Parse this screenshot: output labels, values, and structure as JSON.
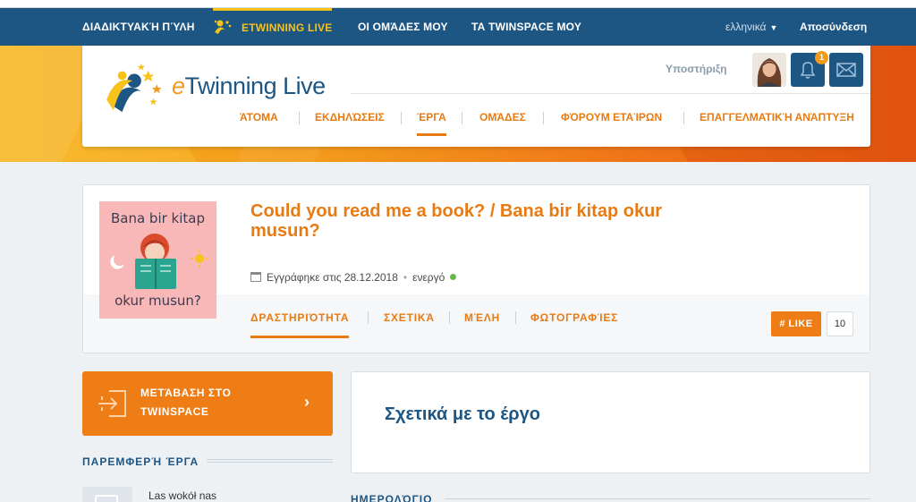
{
  "topnav": {
    "items": [
      {
        "label": "ΔΙΑΔΙΚΤΥΑΚΉ ΠΎΛΗ"
      },
      {
        "label": "ETWINNING LIVE",
        "active": true
      },
      {
        "label": "ΟΙ ΟΜΆΔΕΣ ΜΟΥ"
      },
      {
        "label": "ΤΑ TWINSPACE ΜΟΥ"
      }
    ],
    "language": "ελληνικά",
    "logout": "Αποσύνδεση"
  },
  "header": {
    "brand_e": "e",
    "brand_rest": "Twinning Live",
    "support": "Υποστήριξη",
    "notification_count": "1",
    "subnav": [
      {
        "label": "ΆΤΟΜΑ"
      },
      {
        "label": "ΕΚΔΗΛΏΣΕΙΣ"
      },
      {
        "label": "ΈΡΓΑ",
        "active": true
      },
      {
        "label": "ΟΜΆΔΕΣ"
      },
      {
        "label": "ΦΌΡΟΥΜ ΕΤΑΊΡΩΝ"
      },
      {
        "label": "ΕΠΑΓΓΕΛΜΑΤΙΚΉ ΑΝΆΠΤΥΞΗ"
      }
    ]
  },
  "project": {
    "thumb_line1": "Bana bir kitap",
    "thumb_line2": "okur musun?",
    "title": "Could you read me a book? / Bana bir kitap okur musun?",
    "registered": "Εγγράφηκε στις 28.12.2018",
    "status": "ενεργό",
    "tabs": [
      {
        "label": "ΔΡΑΣΤΗΡΙΌΤΗΤΑ",
        "active": true
      },
      {
        "label": "ΣΧΕΤΙΚΆ"
      },
      {
        "label": "ΜΈΛΗ"
      },
      {
        "label": "ΦΩΤΟΓΡΑΦΊΕΣ"
      }
    ],
    "like_label": "# LIKE",
    "like_count": "10"
  },
  "sidebar": {
    "twinspace_line1": "ΜΕΤΆΒΑΣΗ ΣΤΟ",
    "twinspace_line2": "TWINSPACE",
    "related_heading": "ΠΑΡΕΜΦΕΡΉ ΈΡΓΑ",
    "related_item": "Las wokół nas"
  },
  "main": {
    "about_title": "Σχετικά με το έργο",
    "diary_heading": "ΗΜΕΡΟΛΌΓΙΟ"
  },
  "colors": {
    "navy": "#1d5583",
    "orange": "#e87a12",
    "button_orange": "#ef7d16",
    "active_yellow": "#f6c21b",
    "status_green": "#65b84a"
  },
  "icons": [
    "etwinning-live-icon",
    "notification-bell-icon",
    "mail-icon",
    "calendar-icon",
    "status-dot-icon",
    "twinspace-enter-icon",
    "chevron-right-icon",
    "document-icon"
  ]
}
